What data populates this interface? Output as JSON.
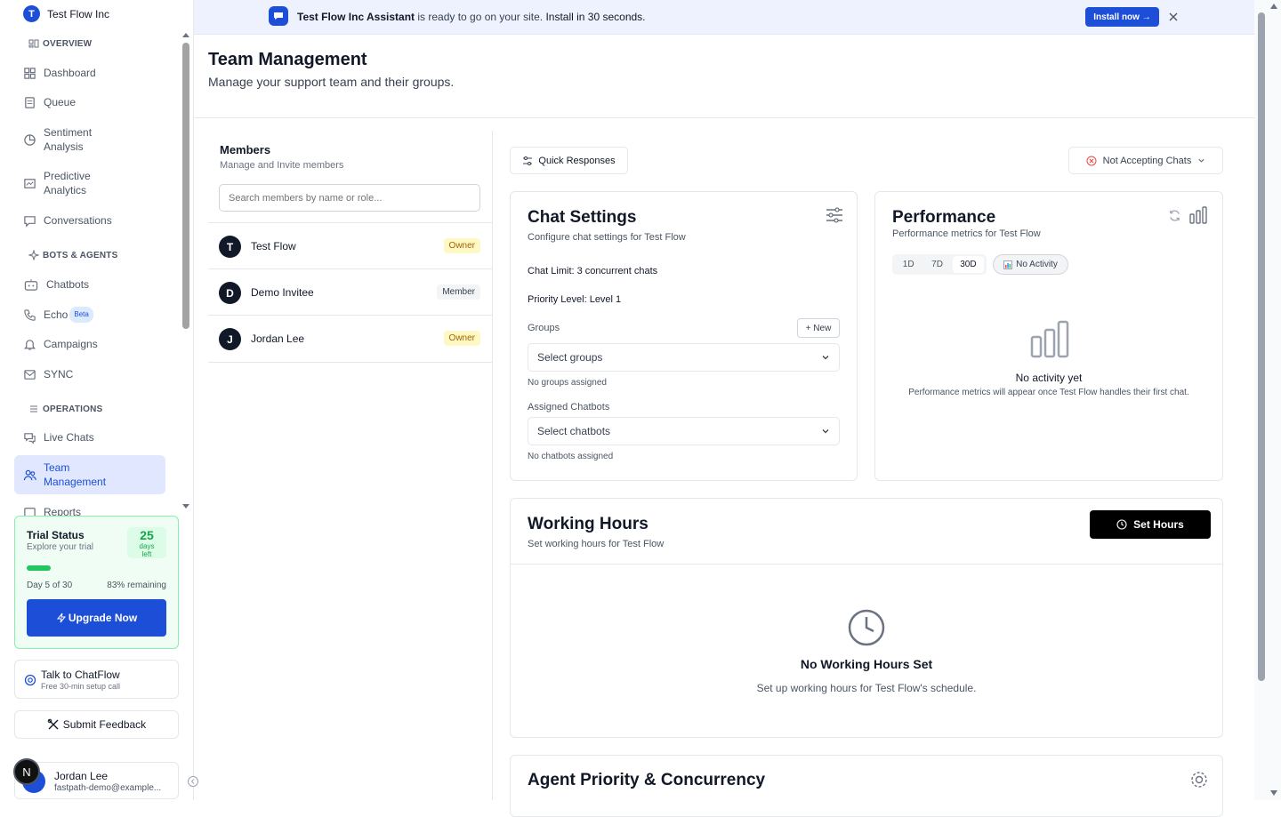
{
  "org": {
    "logo_letter": "T",
    "name": "Test Flow Inc"
  },
  "nav": {
    "sections": {
      "overview": "OVERVIEW",
      "bots": "BOTS & AGENTS",
      "operations": "OPERATIONS"
    },
    "items": [
      {
        "label": "Dashboard",
        "icon": "dashboard-icon"
      },
      {
        "label": "Queue",
        "icon": "queue-icon"
      },
      {
        "label": "Sentiment Analysis",
        "icon": "sentiment-icon"
      },
      {
        "label": "Predictive Analytics",
        "icon": "analytics-icon"
      },
      {
        "label": "Conversations",
        "icon": "chat-bubble-icon"
      },
      {
        "label": "Chatbots",
        "icon": "bot-icon"
      },
      {
        "label": "Echo",
        "badge": "Beta",
        "icon": "phone-icon"
      },
      {
        "label": "Campaigns",
        "icon": "bell-icon"
      },
      {
        "label": "SYNC",
        "icon": "mail-icon"
      },
      {
        "label": "Live Chats",
        "icon": "chats-icon"
      },
      {
        "label": "Team Management",
        "icon": "users-icon",
        "active": true
      },
      {
        "label": "Reports",
        "icon": "reports-icon"
      }
    ]
  },
  "trial": {
    "title": "Trial Status",
    "subtitle": "Explore your trial",
    "days_number": "25",
    "days_label": "days left",
    "progress": 0.17,
    "day_text": "Day 5 of 30",
    "remaining_text": "83% remaining",
    "upgrade_label": "Upgrade Now"
  },
  "talk": {
    "title": "Talk to ChatFlow",
    "subtitle": "Free 30-min setup call"
  },
  "feedback": {
    "label": "Submit Feedback"
  },
  "user": {
    "name": "Jordan Lee",
    "email": "fastpath-demo@example...",
    "avatar_letter": "N"
  },
  "banner": {
    "bold": "Test Flow Inc Assistant",
    "text": " is ready to go on your site.",
    "strong_text": " Install in 30 seconds.",
    "install_label": "Install now →"
  },
  "page": {
    "title": "Team Management",
    "subtitle": "Manage your support team and their groups."
  },
  "members": {
    "title": "Members",
    "subtitle": "Manage and Invite members",
    "search_placeholder": "Search members by name or role...",
    "list": [
      {
        "initial": "T",
        "name": "Test Flow",
        "role": "Owner"
      },
      {
        "initial": "D",
        "name": "Demo Invitee",
        "role": "Member"
      },
      {
        "initial": "J",
        "name": "Jordan Lee",
        "role": "Owner"
      }
    ]
  },
  "toolbar": {
    "quick_responses": "Quick Responses",
    "status": "Not Accepting Chats"
  },
  "chat_settings": {
    "title": "Chat Settings",
    "subtitle": "Configure chat settings for Test Flow",
    "limit_label": "Chat Limit:",
    "limit_value": " 3 concurrent chats",
    "priority_label": "Priority Level:",
    "priority_value": " Level 1",
    "groups_label": "Groups",
    "new_label": "+ New",
    "groups_placeholder": "Select groups",
    "groups_empty": "No groups assigned",
    "chatbots_label": "Assigned Chatbots",
    "chatbots_placeholder": "Select chatbots",
    "chatbots_empty": "No chatbots assigned"
  },
  "performance": {
    "title": "Performance",
    "subtitle": "Performance metrics for Test Flow",
    "ranges": [
      "1D",
      "7D",
      "30D"
    ],
    "selected_range": "30D",
    "activity_badge": "No Activity",
    "empty_title": "No activity yet",
    "empty_text": "Performance metrics will appear once Test Flow handles their first chat."
  },
  "working_hours": {
    "title": "Working Hours",
    "subtitle": "Set working hours for Test Flow",
    "set_label": "Set Hours",
    "empty_title": "No Working Hours Set",
    "empty_text": "Set up working hours for Test Flow's schedule."
  },
  "agent_priority": {
    "title": "Agent Priority & Concurrency"
  },
  "colors": {
    "primary": "#1d4ed8",
    "trial_green": "#22c55e",
    "owner_badge": "#fef9c3",
    "danger": "#ef4444"
  }
}
